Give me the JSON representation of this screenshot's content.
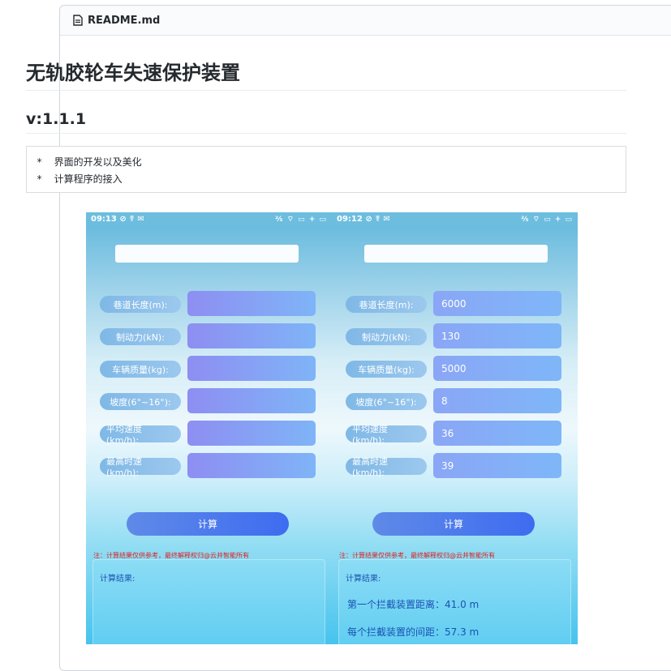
{
  "file_header": {
    "name": "README.md",
    "icon": "file-icon"
  },
  "readme": {
    "title": "无轨胶轮车失速保护装置",
    "version": "v:1.1.1",
    "code_lines": [
      "*  界面的开发以及美化",
      "*  计算程序的接入"
    ]
  },
  "screens": [
    {
      "status": {
        "time": "09:13 ⊘ ☤ ✉",
        "right": "⅖ ⌔ ▭ + ▭"
      },
      "rows": [
        {
          "label": "巷道长度(m):",
          "value": ""
        },
        {
          "label": "制动力(kN):",
          "value": ""
        },
        {
          "label": "车辆质量(kg):",
          "value": ""
        },
        {
          "label": "坡度(6°~16°):",
          "value": ""
        },
        {
          "label": "平均速度(km/h):",
          "value": ""
        },
        {
          "label": "最高时速(km/h):",
          "value": ""
        }
      ],
      "calc_label": "计算",
      "note": "注：计算结果仅供参考，最终解释权归@云井智能所有",
      "result_title": "计算结果:",
      "result_lines": []
    },
    {
      "status": {
        "time": "09:12 ⊘ ☤ ✉",
        "right": "⅖ ⌔ ▭ + ▭"
      },
      "rows": [
        {
          "label": "巷道长度(m):",
          "value": "6000"
        },
        {
          "label": "制动力(kN):",
          "value": "130"
        },
        {
          "label": "车辆质量(kg):",
          "value": "5000"
        },
        {
          "label": "坡度(6°~16°):",
          "value": "8"
        },
        {
          "label": "平均速度(km/h):",
          "value": "36"
        },
        {
          "label": "最高时速(km/h):",
          "value": "39"
        }
      ],
      "calc_label": "计算",
      "note": "注：计算结果仅供参考，最终解释权归@云井智能所有",
      "result_title": "计算结果:",
      "result_lines": [
        "第一个拦截装置距离：41.0 m",
        "每个拦截装置的间距：57.3 m"
      ]
    }
  ]
}
